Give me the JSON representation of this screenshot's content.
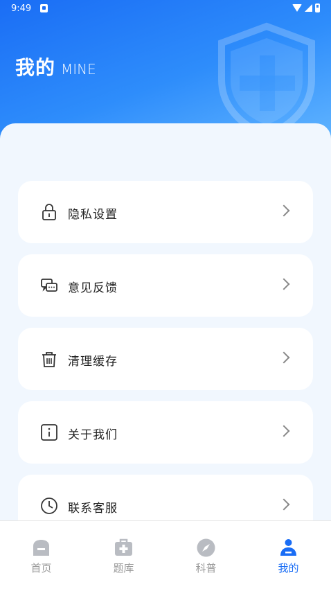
{
  "status_bar": {
    "time": "9:49"
  },
  "header": {
    "title": "我的",
    "subtitle": "MINE"
  },
  "menu": [
    {
      "label": "隐私设置",
      "icon": "lock-icon"
    },
    {
      "label": "意见反馈",
      "icon": "chat-icon"
    },
    {
      "label": "清理缓存",
      "icon": "trash-icon"
    },
    {
      "label": "关于我们",
      "icon": "info-icon"
    },
    {
      "label": "联系客服",
      "icon": "clock-icon"
    }
  ],
  "tabs": [
    {
      "label": "首页",
      "icon": "home-icon",
      "active": false
    },
    {
      "label": "题库",
      "icon": "medical-kit-icon",
      "active": false
    },
    {
      "label": "科普",
      "icon": "compass-icon",
      "active": false
    },
    {
      "label": "我的",
      "icon": "user-icon",
      "active": true
    }
  ],
  "colors": {
    "accent": "#1a6df5",
    "inactive": "#b9bcc2",
    "background": "#f1f7fe"
  }
}
